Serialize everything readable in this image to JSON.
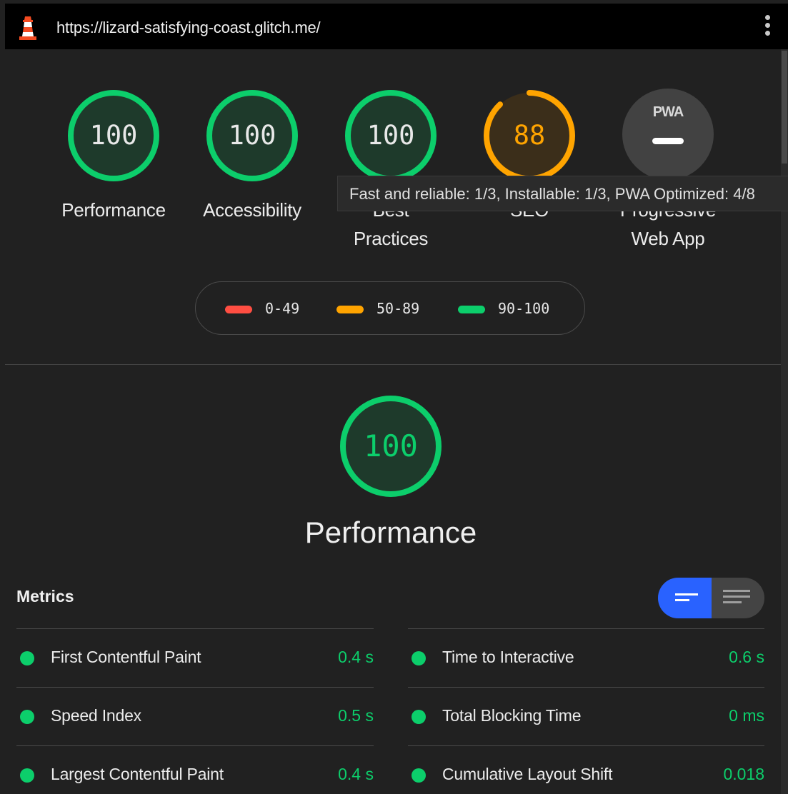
{
  "header": {
    "url": "https://lizard-satisfying-coast.glitch.me/",
    "logo_icon": "lighthouse-icon",
    "menu_icon": "kebab-menu-icon"
  },
  "colors": {
    "pass": "#0cce6b",
    "average": "#ffa400",
    "fail": "#ff4e42",
    "accent": "#2962ff"
  },
  "categories": [
    {
      "label": "Performance",
      "score": "100",
      "score_fraction": 1.0
    },
    {
      "label": "Accessibility",
      "score": "100",
      "score_fraction": 1.0
    },
    {
      "label_line1": "Best",
      "label_line2": "Practices",
      "score": "100",
      "score_fraction": 1.0
    },
    {
      "label": "SEO",
      "score": "88",
      "score_fraction": 0.88
    },
    {
      "label_line1": "Progressive",
      "label_line2": "Web App",
      "badge_text": "PWA"
    }
  ],
  "tooltip": {
    "text": "Fast and reliable: 1/3, Installable: 1/3, PWA Optimized: 4/8"
  },
  "legend": [
    {
      "range": "0-49"
    },
    {
      "range": "50-89"
    },
    {
      "range": "90-100"
    }
  ],
  "performance": {
    "score": "100",
    "title": "Performance"
  },
  "metrics": {
    "heading": "Metrics",
    "items": [
      {
        "name": "First Contentful Paint",
        "value": "0.4 s"
      },
      {
        "name": "Time to Interactive",
        "value": "0.6 s"
      },
      {
        "name": "Speed Index",
        "value": "0.5 s"
      },
      {
        "name": "Total Blocking Time",
        "value": "0 ms"
      },
      {
        "name": "Largest Contentful Paint",
        "value": "0.4 s"
      },
      {
        "name": "Cumulative Layout Shift",
        "value": "0.018"
      }
    ]
  }
}
